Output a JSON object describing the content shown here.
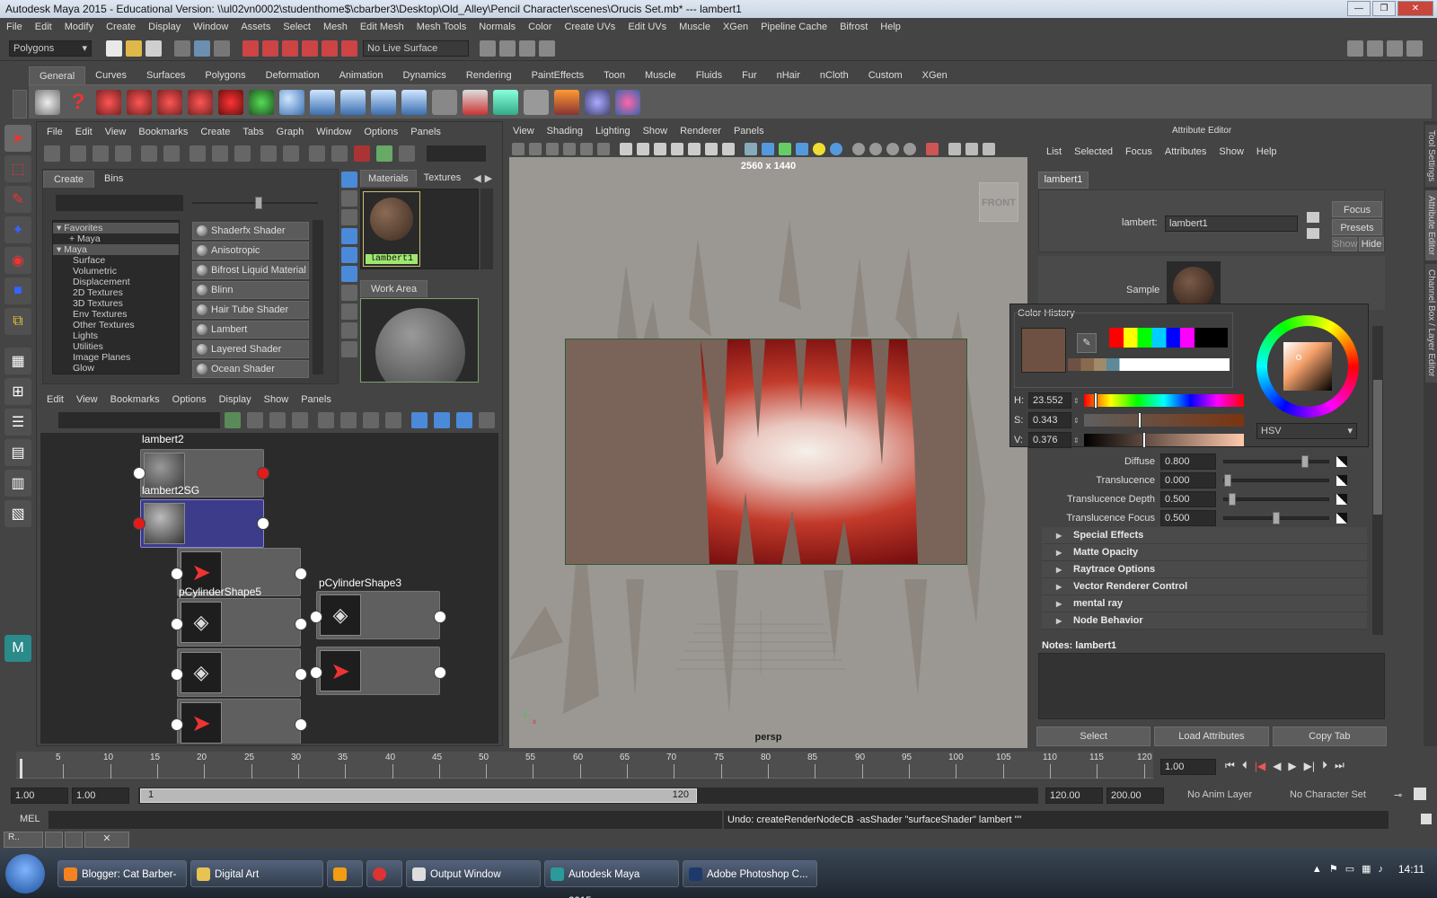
{
  "window": {
    "title": "Autodesk Maya 2015 - Educational Version: \\\\ul02vn0002\\studenthome$\\cbarber3\\Desktop\\Old_Alley\\Pencil Character\\scenes\\Orucis Set.mb*  ---  lambert1"
  },
  "menubar": [
    "File",
    "Edit",
    "Modify",
    "Create",
    "Display",
    "Window",
    "Assets",
    "Select",
    "Mesh",
    "Edit Mesh",
    "Mesh Tools",
    "Normals",
    "Color",
    "Create UVs",
    "Edit UVs",
    "Muscle",
    "XGen",
    "Pipeline Cache",
    "Bifrost",
    "Help"
  ],
  "statusline": {
    "mode": "Polygons",
    "live_surface": "No Live Surface"
  },
  "shelf": {
    "tabs": [
      "General",
      "Curves",
      "Surfaces",
      "Polygons",
      "Deformation",
      "Animation",
      "Dynamics",
      "Rendering",
      "PaintEffects",
      "Toon",
      "Muscle",
      "Fluids",
      "Fur",
      "nHair",
      "nCloth",
      "Custom",
      "XGen"
    ],
    "active": "General"
  },
  "hypershade": {
    "menu": [
      "File",
      "Edit",
      "View",
      "Bookmarks",
      "Create",
      "Tabs",
      "Graph",
      "Window",
      "Options",
      "Panels"
    ],
    "create_tabs": [
      "Create",
      "Bins"
    ],
    "tree": {
      "favorites": "Favorites",
      "maya_fav": "+ Maya",
      "maya": "Maya",
      "items": [
        "Surface",
        "Volumetric",
        "Displacement",
        "2D Textures",
        "3D Textures",
        "Env Textures",
        "Other Textures",
        "Lights",
        "Utilities",
        "Image Planes",
        "Glow"
      ]
    },
    "shaders": [
      "Shaderfx Shader",
      "Anisotropic",
      "Bifrost Liquid Material",
      "Blinn",
      "Hair Tube Shader",
      "Lambert",
      "Layered Shader",
      "Ocean Shader"
    ],
    "mat_tabs": [
      "Materials",
      "Textures"
    ],
    "material_label": "lambert1",
    "work_area": "Work Area",
    "graph_menu": [
      "Edit",
      "View",
      "Bookmarks",
      "Options",
      "Display",
      "Show",
      "Panels"
    ],
    "nodes": {
      "lambert2": "lambert2",
      "lambert2sg": "lambert2SG",
      "cyl5": "pCylinderShape5",
      "cyl3": "pCylinderShape3"
    }
  },
  "viewport": {
    "menu": [
      "View",
      "Shading",
      "Lighting",
      "Show",
      "Renderer",
      "Panels"
    ],
    "resolution": "2560 x 1440",
    "cube_label": "FRONT",
    "camera": "persp"
  },
  "attribute_editor": {
    "title": "Attribute Editor",
    "menu": [
      "List",
      "Selected",
      "Focus",
      "Attributes",
      "Show",
      "Help"
    ],
    "tab": "lambert1",
    "type_label": "lambert:",
    "name_value": "lambert1",
    "buttons": {
      "focus": "Focus",
      "presets": "Presets",
      "show": "Show",
      "hide": "Hide"
    },
    "sample": "Sample",
    "attrs": [
      {
        "label": "Diffuse",
        "value": "0.800",
        "pos": 0.8
      },
      {
        "label": "Translucence",
        "value": "0.000",
        "pos": 0.0
      },
      {
        "label": "Translucence Depth",
        "value": "0.500",
        "pos": 0.05
      },
      {
        "label": "Translucence Focus",
        "value": "0.500",
        "pos": 0.5
      }
    ],
    "sections": [
      "Special Effects",
      "Matte Opacity",
      "Raytrace Options",
      "Vector Renderer Control",
      "mental ray",
      "Node Behavior"
    ],
    "notes": "Notes:  lambert1",
    "footer": [
      "Select",
      "Load Attributes",
      "Copy Tab"
    ]
  },
  "color_history": {
    "title": "Color History",
    "swatch": "#6e5142",
    "h": {
      "label": "H:",
      "value": "23.552",
      "pos": 0.065
    },
    "s": {
      "label": "S:",
      "value": "0.343",
      "pos": 0.343
    },
    "v": {
      "label": "V:",
      "value": "0.376",
      "pos": 0.376
    },
    "mode": "HSV"
  },
  "side_tabs": [
    "Tool Settings",
    "Attribute Editor",
    "Channel Box / Layer Editor"
  ],
  "timeline": {
    "ticks": [
      "5",
      "10",
      "15",
      "20",
      "25",
      "30",
      "35",
      "40",
      "45",
      "50",
      "55",
      "60",
      "65",
      "70",
      "75",
      "80",
      "85",
      "90",
      "95",
      "100",
      "105",
      "110",
      "115",
      "120"
    ],
    "current": "1.00"
  },
  "range": {
    "start": "1.00",
    "start2": "1.00",
    "slider_start": "1",
    "slider_end": "120",
    "end": "120.00",
    "end2": "200.00",
    "anim_layer": "No Anim Layer",
    "char_set": "No Character Set"
  },
  "mel": {
    "label": "MEL",
    "result": "Undo: createRenderNodeCB -asShader \"surfaceShader\" lambert \"\""
  },
  "taskbar": {
    "tasks": [
      "Blogger: Cat Barber- ...",
      "Digital Art",
      "",
      "",
      "Output Window",
      "Autodesk Maya 2015...",
      "Adobe Photoshop C..."
    ],
    "clock": "14:11"
  },
  "colors": {
    "accent_green": "#9fe870",
    "port_red": "#e31b1b",
    "node_selected": "#3c3c8a"
  }
}
